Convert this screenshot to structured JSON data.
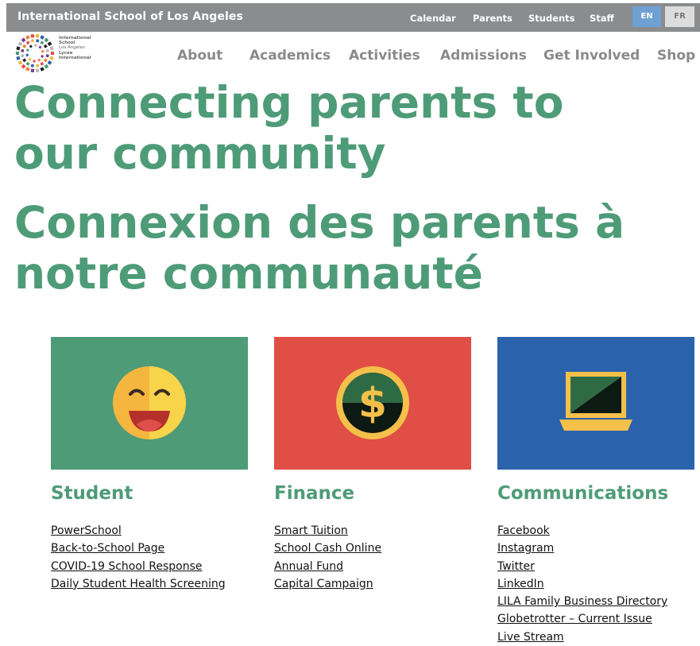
{
  "header": {
    "site_title": "International School of Los Angeles",
    "top_links": [
      "Calendar",
      "Parents",
      "Students",
      "Staff"
    ],
    "languages": {
      "en": "EN",
      "fr": "FR"
    }
  },
  "logo": {
    "lines": [
      "International",
      "School",
      "Los Angeles",
      "Lycée",
      "International"
    ]
  },
  "nav": [
    "About",
    "Academics",
    "Activities",
    "Admissions",
    "Get Involved",
    "Shop"
  ],
  "hero": {
    "title_en": "Connecting parents to our community",
    "title_fr": "Connexion des parents à notre communauté"
  },
  "sections": [
    {
      "title": "Student",
      "icon": "smiley-face-icon",
      "bg": "#4e9b78",
      "links": [
        "PowerSchool",
        "Back-to-School Page",
        "COVID-19 School Response",
        "Daily Student Health Screening"
      ]
    },
    {
      "title": "Finance",
      "icon": "dollar-coin-icon",
      "bg": "#e04e45",
      "links": [
        "Smart Tuition",
        "School Cash Online",
        "Annual Fund",
        "Capital Campaign"
      ]
    },
    {
      "title": "Communications",
      "icon": "laptop-icon",
      "bg": "#2a62ac",
      "links": [
        "Facebook",
        "Instagram",
        "Twitter",
        "LinkedIn",
        "LILA Family Business Directory",
        "Globetrotter – Current Issue",
        "Live Stream"
      ]
    }
  ],
  "colors": {
    "accent": "#4e9b78",
    "topbar": "#8b8c8e",
    "nav": "#8a8a8a"
  }
}
